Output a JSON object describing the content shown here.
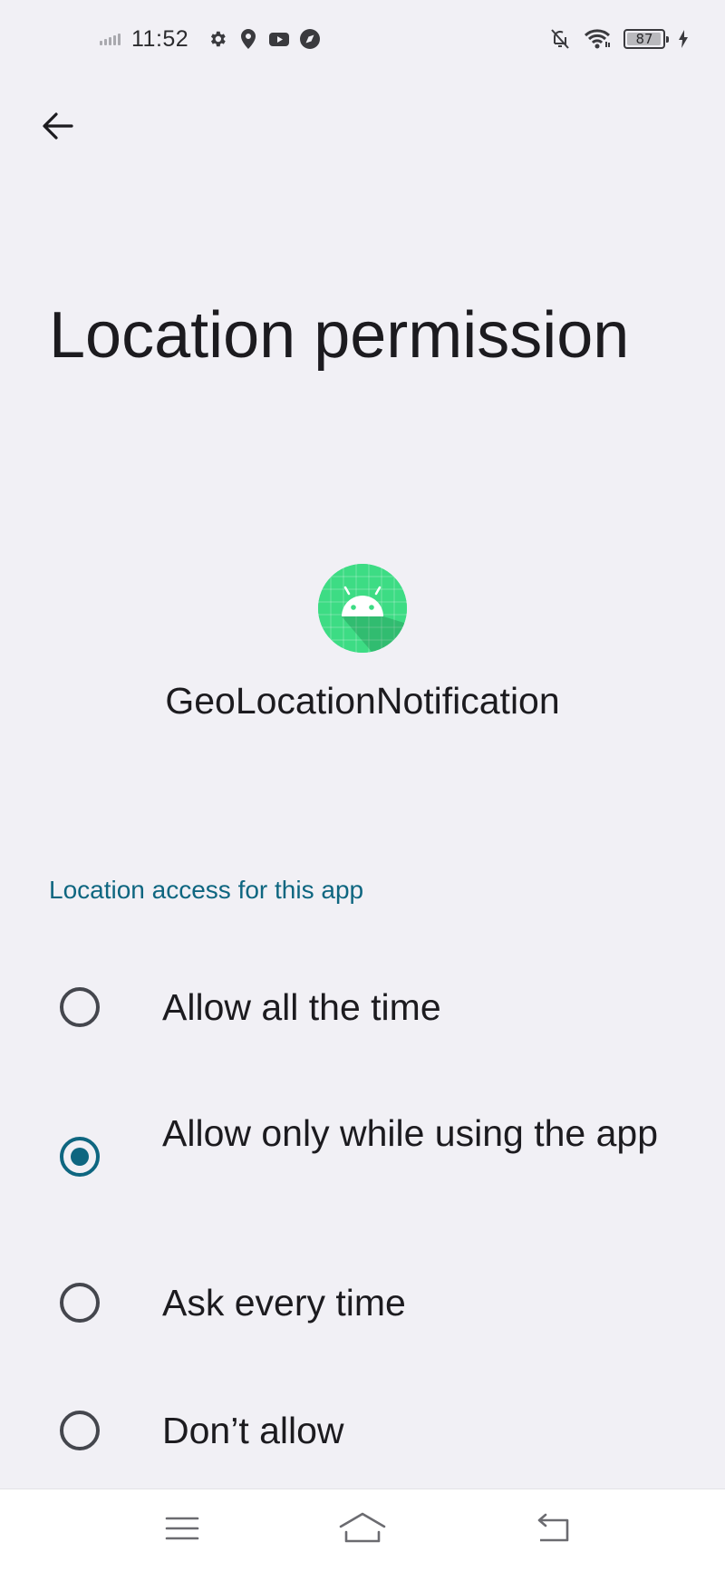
{
  "status_bar": {
    "time": "11:52",
    "battery_level": "87",
    "icons": [
      "signal-icon",
      "gear-icon",
      "location-pin-icon",
      "youtube-icon",
      "compass-icon",
      "notifications-off-icon",
      "wifi-icon",
      "battery-icon",
      "charging-icon"
    ]
  },
  "header": {
    "title": "Location permission",
    "back_icon": "arrow-back-icon"
  },
  "app": {
    "name": "GeoLocationNotification",
    "icon": "android-robot-icon",
    "icon_color": "#3ddc84"
  },
  "section": {
    "title": "Location access for this app"
  },
  "options": [
    {
      "label": "Allow all the time",
      "selected": false
    },
    {
      "label": "Allow only while using the app",
      "selected": true
    },
    {
      "label": "Ask every time",
      "selected": false
    },
    {
      "label": "Don’t allow",
      "selected": false
    }
  ],
  "nav_bar": {
    "icons": [
      "menu-icon",
      "home-icon",
      "back-nav-icon"
    ]
  },
  "colors": {
    "accent": "#0e6680",
    "background": "#f1f0f5"
  }
}
